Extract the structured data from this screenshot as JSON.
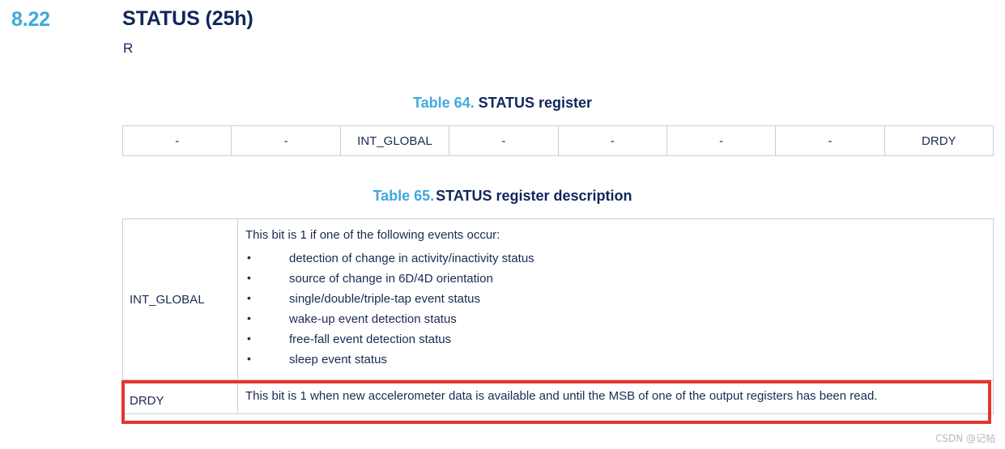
{
  "section": {
    "number": "8.22",
    "title": "STATUS (25h)",
    "access": "R"
  },
  "table64": {
    "caption_number": "Table 64.",
    "caption_title": "STATUS register",
    "bits": [
      "-",
      "-",
      "INT_GLOBAL",
      "-",
      "-",
      "-",
      "-",
      "DRDY"
    ]
  },
  "table65": {
    "caption_number": "Table 65.",
    "caption_title": "STATUS register description",
    "rows": [
      {
        "name": "INT_GLOBAL",
        "intro": "This bit is 1 if one of the following events occur:",
        "bullets": [
          "detection of change in activity/inactivity status",
          "source of change in 6D/4D orientation",
          "single/double/triple-tap event status",
          "wake-up event detection status",
          "free-fall event detection status",
          "sleep event status"
        ]
      },
      {
        "name": "DRDY",
        "description": "This bit is 1 when new accelerometer data is available and until the MSB of one of the output registers has been read."
      }
    ]
  },
  "annotation": {
    "highlight_color": "#e8342b"
  },
  "watermark": {
    "text": "CSDN @记帖"
  },
  "colors": {
    "accent_blue": "#3fa9dc",
    "heading_navy": "#10265c",
    "body_navy": "#1b2a52",
    "table_border": "#c6d0d6"
  }
}
